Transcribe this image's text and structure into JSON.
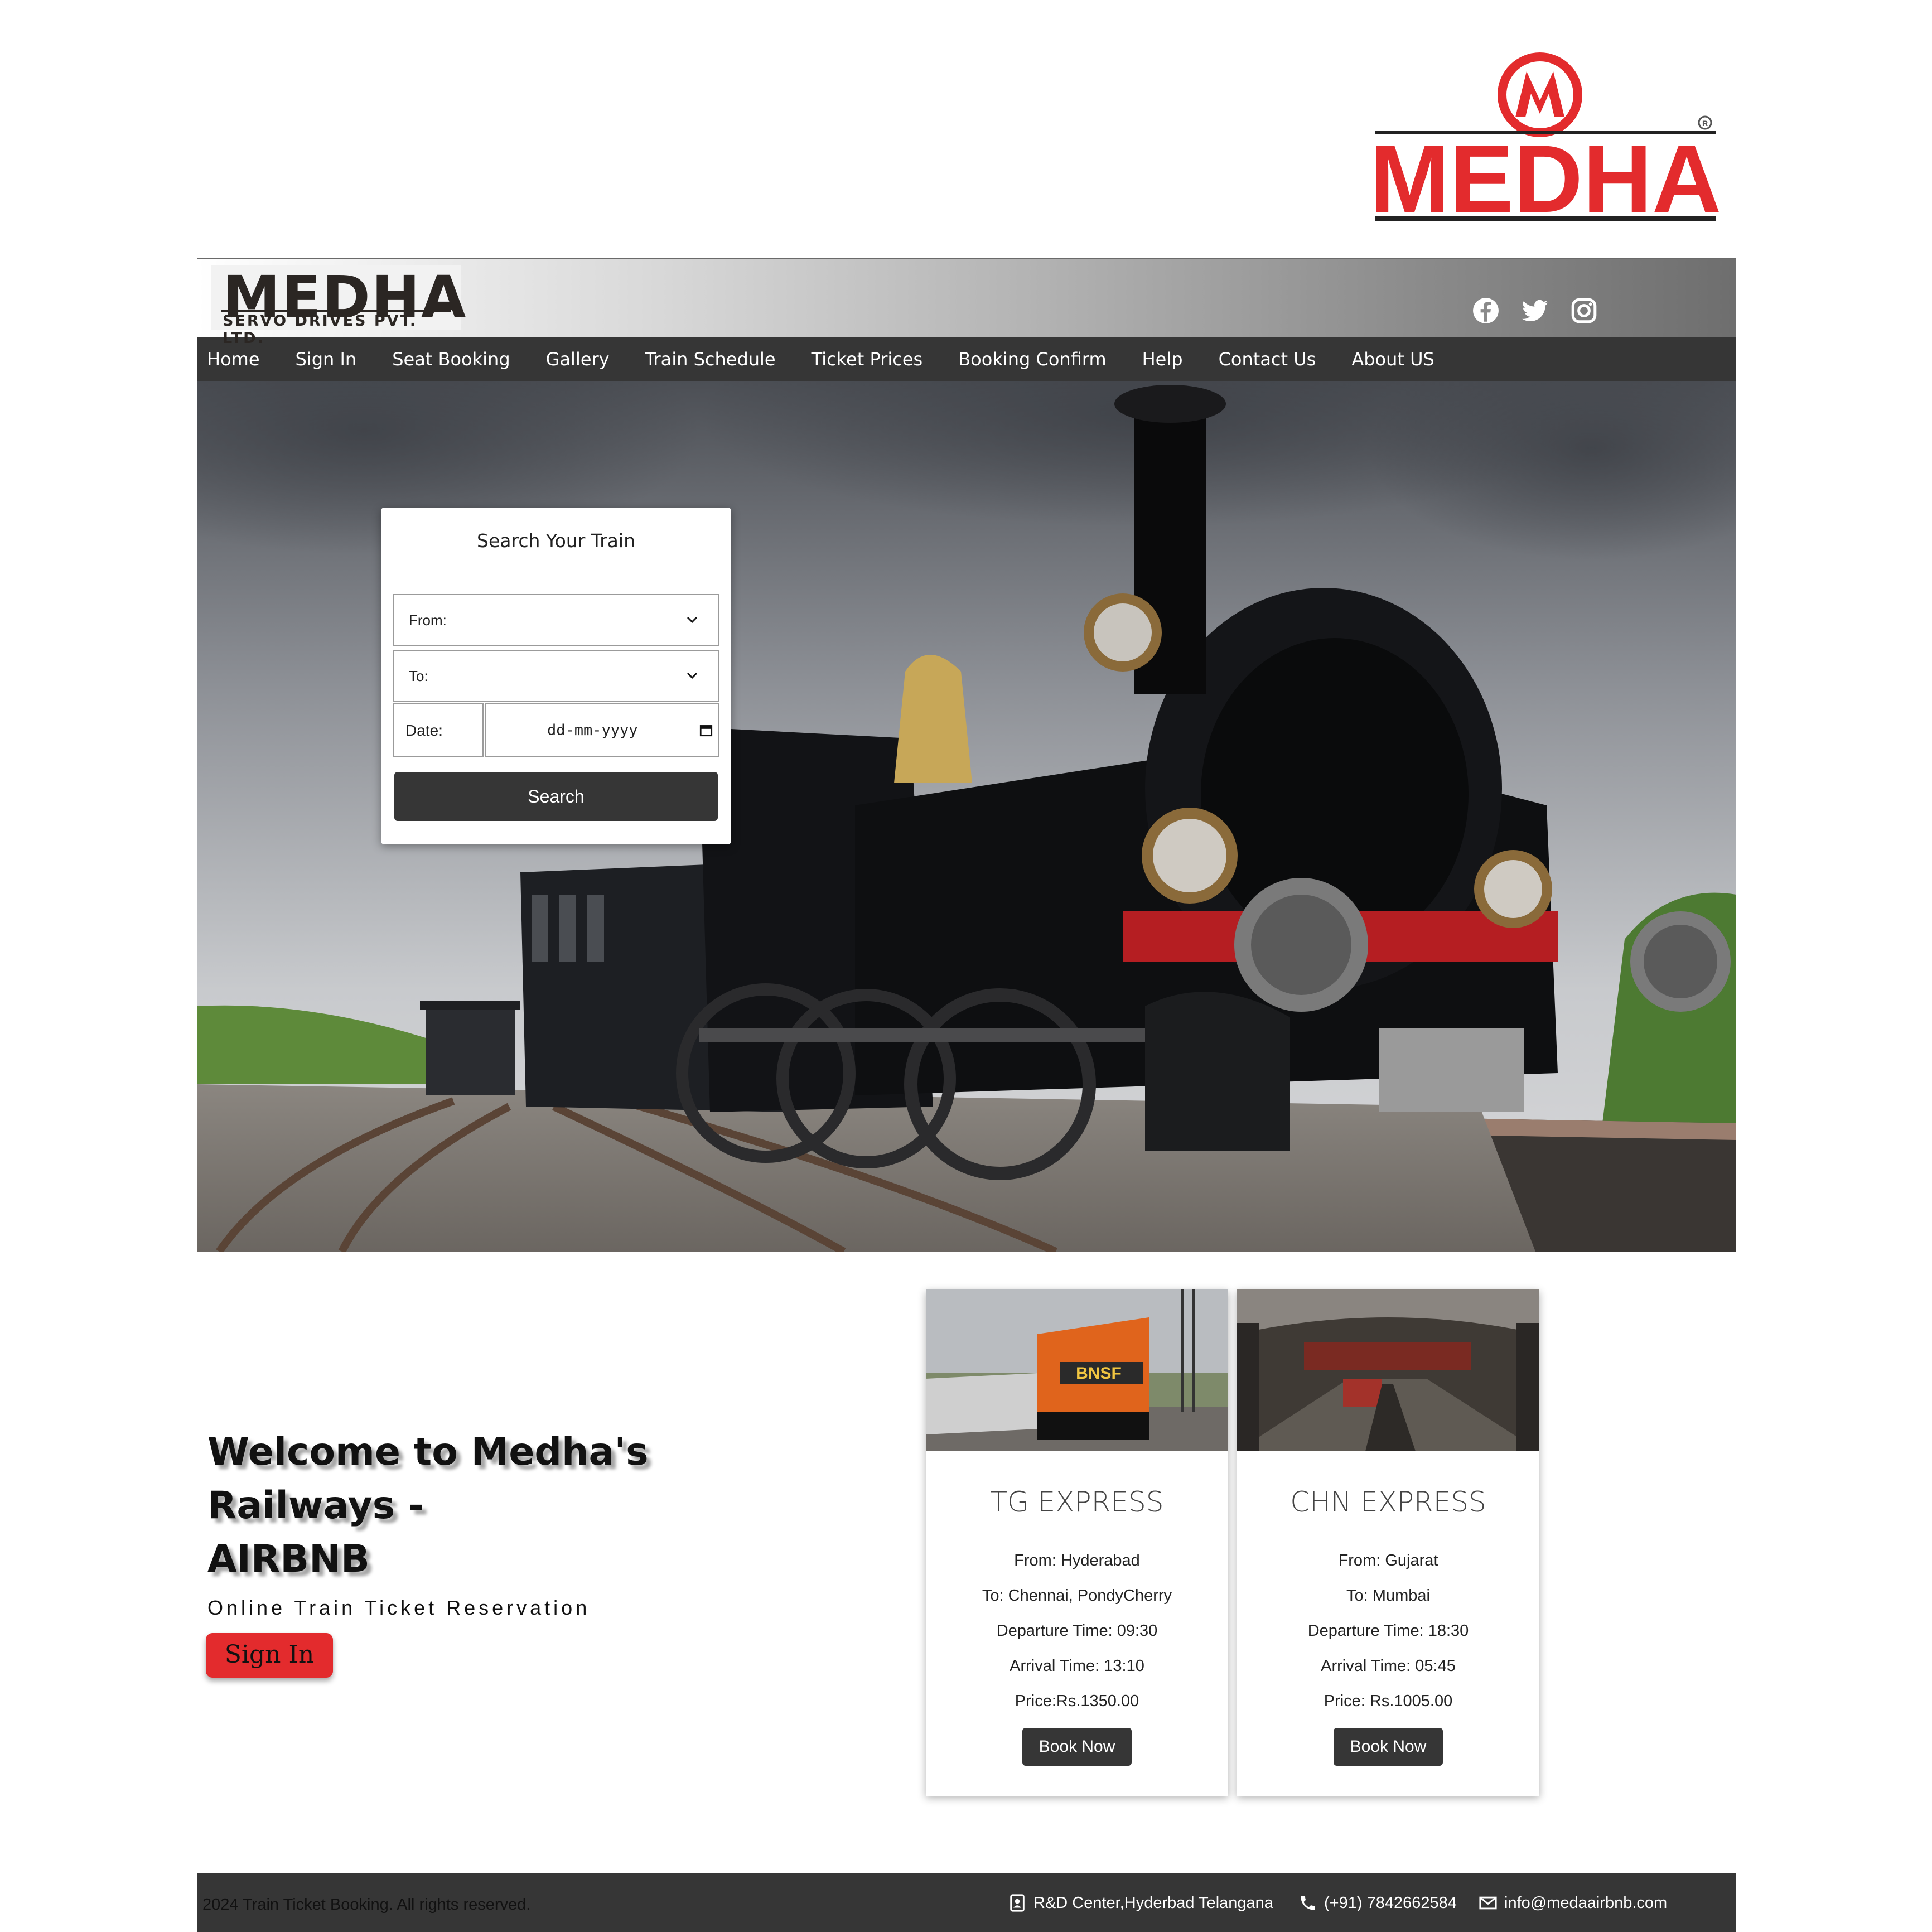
{
  "top_logo": {
    "text": "MEDHA",
    "mark": "M",
    "registered": "®",
    "color": "#e32b2d"
  },
  "header": {
    "brand_title": "MEDHA",
    "brand_subtitle": "SERVO DRIVES PVT. LTD.",
    "social_icons": [
      "facebook-icon",
      "twitter-icon",
      "instagram-icon"
    ]
  },
  "nav": {
    "items": [
      "Home",
      "Sign In",
      "Seat Booking",
      "Gallery",
      "Train Schedule",
      "Ticket Prices",
      "Booking Confirm",
      "Help",
      "Contact Us",
      "About US"
    ]
  },
  "search": {
    "title": "Search Your Train",
    "from_label": "From:",
    "to_label": "To:",
    "date_label": "Date:",
    "date_placeholder": "dd-mm-yyyy",
    "button": "Search"
  },
  "welcome": {
    "heading_line1": "Welcome to Medha's Railways -",
    "heading_line2": "AIRBNB",
    "tagline": "Online Train Ticket Reservation",
    "signin_button": "Sign In"
  },
  "trains": [
    {
      "name": "TG EXPRESS",
      "from": "From: Hyderabad",
      "to": "To: Chennai, PondyCherry",
      "departure": "Departure Time: 09:30",
      "arrival": "Arrival Time: 13:10",
      "price": "Price:Rs.1350.00",
      "button": "Book Now"
    },
    {
      "name": "CHN EXPRESS",
      "from": "From: Gujarat",
      "to": "To: Mumbai",
      "departure": "Departure Time: 18:30",
      "arrival": "Arrival Time: 05:45",
      "price": "Price: Rs.1005.00",
      "button": "Book Now"
    }
  ],
  "footer": {
    "copyright": "2024 Train Ticket Booking. All rights reserved.",
    "address": "R&D Center,Hyderbad Telangana",
    "phone": "(+91) 7842662584",
    "email": "info@medaairbnb.com"
  },
  "colors": {
    "accent_red": "#e32b2d",
    "dark": "#363636"
  }
}
